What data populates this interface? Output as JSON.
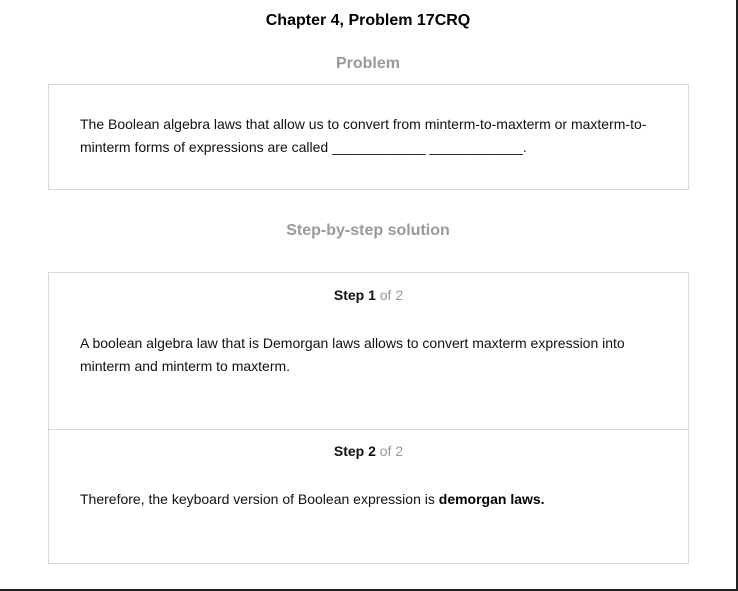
{
  "title": "Chapter 4, Problem 17CRQ",
  "problem": {
    "label": "Problem",
    "text": "The Boolean algebra laws that allow us to convert from minterm-to-maxterm or maxterm-to-minterm forms of expressions are called ____________ ____________."
  },
  "solution": {
    "label": "Step-by-step solution",
    "steps": [
      {
        "step_word": "Step 1",
        "of_text": "of 2",
        "text": "A boolean algebra law that is Demorgan laws allows to convert maxterm expression into minterm and minterm to maxterm."
      },
      {
        "step_word": "Step 2",
        "of_text": "of 2",
        "text_prefix": "Therefore, the keyboard version of Boolean expression is ",
        "text_bold": "demorgan laws."
      }
    ]
  }
}
